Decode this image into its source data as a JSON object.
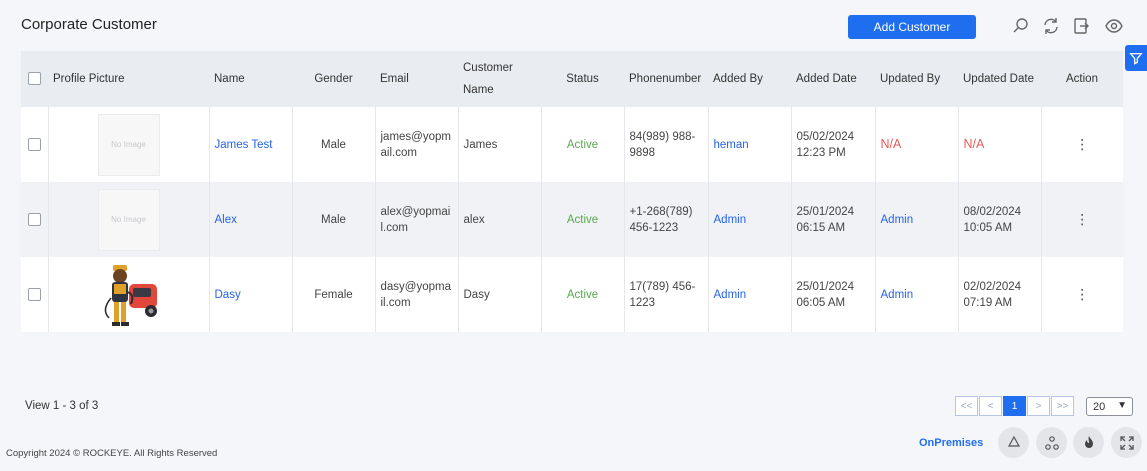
{
  "page": {
    "title": "Corporate Customer"
  },
  "toolbar": {
    "add_label": "Add Customer",
    "icons": [
      "search-icon",
      "refresh-icon",
      "export-icon",
      "eye-icon"
    ]
  },
  "table": {
    "headers": [
      "Profile Picture",
      "Name",
      "Gender",
      "Email",
      "Customer Name",
      "Status",
      "Phonenumber",
      "Added By",
      "Added Date",
      "Updated By",
      "Updated Date",
      "Action"
    ],
    "no_image_text": "No Image",
    "rows": [
      {
        "name": "James Test",
        "gender": "Male",
        "email": "james@yopmail.com",
        "customer_name": "James",
        "status": "Active",
        "phone": "84(989) 988-9898",
        "added_by": "heman",
        "added_date": "05/02/2024 12:23 PM",
        "updated_by": "N/A",
        "updated_date": "N/A",
        "picture": "none"
      },
      {
        "name": "Alex",
        "gender": "Male",
        "email": "alex@yopmail.com",
        "customer_name": "alex",
        "status": "Active",
        "phone": "+1-268(789) 456-1223",
        "added_by": "Admin",
        "added_date": "25/01/2024 06:15 AM",
        "updated_by": "Admin",
        "updated_date": "08/02/2024 10:05 AM",
        "picture": "none"
      },
      {
        "name": "Dasy",
        "gender": "Female",
        "email": "dasy@yopmail.com",
        "customer_name": "Dasy",
        "status": "Active",
        "phone": "17(789) 456-1223",
        "added_by": "Admin",
        "added_date": "25/01/2024 06:05 AM",
        "updated_by": "Admin",
        "updated_date": "02/02/2024 07:19 AM",
        "picture": "illustration"
      }
    ]
  },
  "footer": {
    "view_text": "View 1 - 3 of 3",
    "pager": {
      "first": "<<",
      "prev": "<",
      "current": "1",
      "next": ">",
      "last": ">>"
    },
    "page_size": "20",
    "copyright": "Copyright 2024 © ROCKEYE. All Rights Reserved",
    "onpremises": "OnPremises"
  },
  "colors": {
    "accent": "#1f6ef0",
    "active": "#5aa84f",
    "na": "#e45c5c",
    "link": "#2563eb"
  }
}
